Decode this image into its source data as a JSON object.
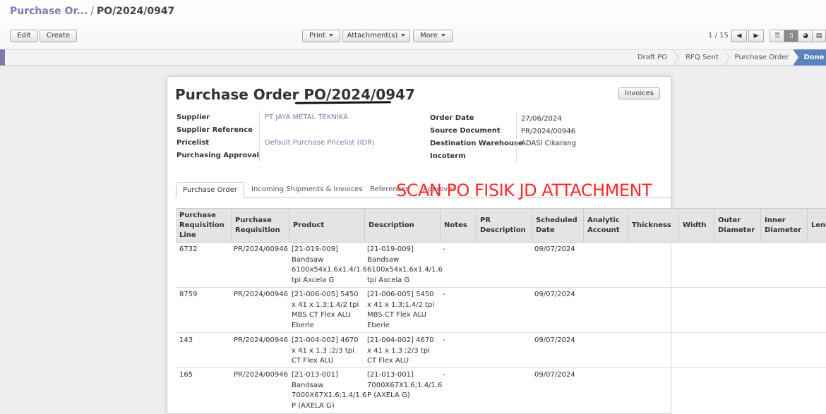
{
  "breadcrumb": {
    "parent": "Purchase Or...",
    "separator": "/",
    "current": "PO/2024/0947"
  },
  "toolbar": {
    "edit": "Edit",
    "create": "Create",
    "print": "Print",
    "attachments": "Attachment(s)",
    "more": "More"
  },
  "pager": {
    "text": "1 / 15"
  },
  "view_switcher": [
    "list-icon",
    "form-icon",
    "graph-icon",
    "calendar-icon"
  ],
  "status_stages": [
    "Draft PO",
    "RFQ Sent",
    "Purchase Order",
    "Done"
  ],
  "status_active": "Done",
  "form": {
    "title_prefix": "Purchase Order",
    "title_number": "PO/2024/0947",
    "invoices_button": "Invoices",
    "left_fields": [
      {
        "label": "Supplier",
        "value": "PT JAYA METAL TEKNIKA"
      },
      {
        "label": "Supplier Reference",
        "value": ""
      },
      {
        "label": "Pricelist",
        "value": "Default Purchase Pricelist (IDR)"
      },
      {
        "label": "Purchasing Approval",
        "value": ""
      }
    ],
    "right_fields": [
      {
        "label": "Order Date",
        "value": "27/06/2024"
      },
      {
        "label": "Source Document",
        "value": "PR/2024/00946"
      },
      {
        "label": "Destination Warehouse",
        "value": "ADASI Cikarang"
      },
      {
        "label": "Incoterm",
        "value": ""
      }
    ],
    "tabs": [
      "Purchase Order",
      "Incoming Shipments & Invoices",
      "References",
      "Approval"
    ],
    "annotation": "SCAN PO FISIK JD ATTACHMENT"
  },
  "table": {
    "headers": [
      "Purchase Requisition Line",
      "Purchase Requisition",
      "Product",
      "Description",
      "Notes",
      "PR Description",
      "Scheduled Date",
      "Analytic Account",
      "Thickness",
      "Width",
      "Outer Diameter",
      "Inner Diameter",
      "Length"
    ],
    "rows": [
      {
        "line": "6732",
        "pr": "PR/2024/00946",
        "product": "[21-019-009] Bandsaw 6100x54x1.6x1.4/1.6 tpi Axcela G",
        "description": "[21-019-009] Bandsaw 6100x54x1.6x1.4/1.6 tpi Axcela G",
        "notes": "-",
        "date": "09/07/2024"
      },
      {
        "line": "8759",
        "pr": "PR/2024/00946",
        "product": "[21-006-005] 5450 x 41 x 1.3;1.4/2 tpi MBS CT Flex ALU Eberle",
        "description": "[21-006-005] 5450 x 41 x 1.3;1.4/2 tpi MBS CT Flex ALU Eberle",
        "notes": "-",
        "date": "09/07/2024"
      },
      {
        "line": "143",
        "pr": "PR/2024/00946",
        "product": "[21-004-002] 4670 x 41 x 1.3 ;2/3 tpi CT Flex ALU",
        "description": "[21-004-002] 4670 x 41 x 1.3 ;2/3 tpi CT Flex ALU",
        "notes": "-",
        "date": "09/07/2024"
      },
      {
        "line": "165",
        "pr": "PR/2024/00946",
        "product": "[21-013-001] Bandsaw 7000X67X1.6;1.4/1.6 P (AXELA G)",
        "description": "[21-013-001] 7000X67X1.6;1.4/1.6 P (AXELA G)",
        "notes": "-",
        "date": "09/07/2024"
      }
    ]
  },
  "colors": {
    "link": "#7c7bad",
    "done_stage": "#5b83be",
    "annotation": "#ff2a2a"
  }
}
